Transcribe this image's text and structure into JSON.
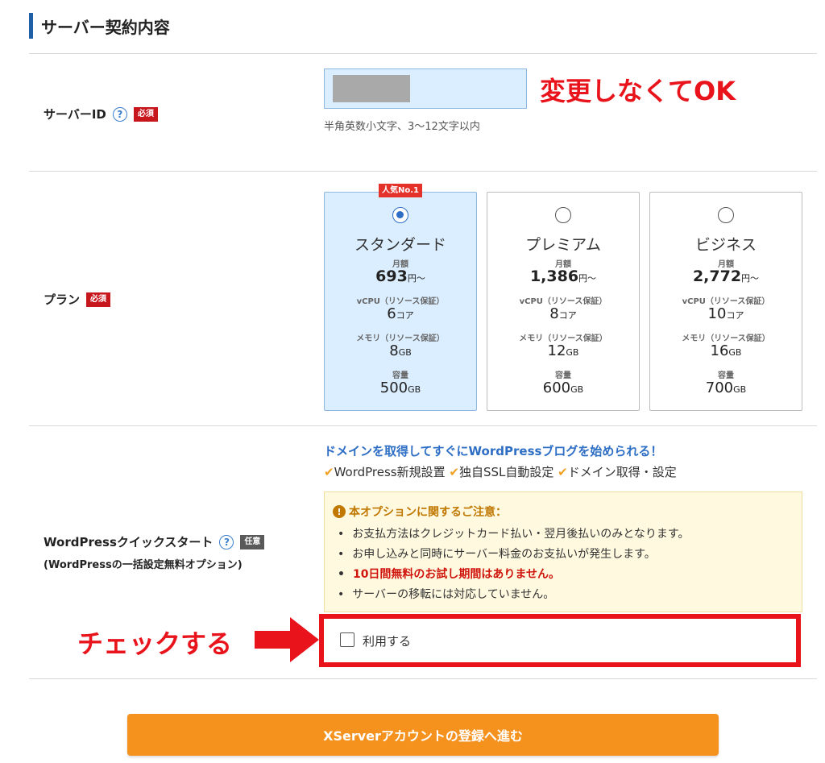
{
  "section": {
    "title": "サーバー契約内容"
  },
  "server_id": {
    "label": "サーバーID",
    "required_badge": "必須",
    "hint": "半角英数小文字、3～12文字以内",
    "annotation": "変更しなくてOK"
  },
  "plan": {
    "label": "プラン",
    "required_badge": "必須",
    "popular_badge": "人気No.1",
    "selected": "スタンダード",
    "items": [
      {
        "name": "スタンダード",
        "price_label": "月額",
        "price": "693",
        "price_unit": "円～",
        "cpu_label": "vCPU（リソース保証）",
        "cpu": "6",
        "cpu_unit": "コア",
        "mem_label": "メモリ（リソース保証）",
        "mem": "8",
        "mem_unit": "GB",
        "disk_label": "容量",
        "disk": "500",
        "disk_unit": "GB"
      },
      {
        "name": "プレミアム",
        "price_label": "月額",
        "price": "1,386",
        "price_unit": "円～",
        "cpu_label": "vCPU（リソース保証）",
        "cpu": "8",
        "cpu_unit": "コア",
        "mem_label": "メモリ（リソース保証）",
        "mem": "12",
        "mem_unit": "GB",
        "disk_label": "容量",
        "disk": "600",
        "disk_unit": "GB"
      },
      {
        "name": "ビジネス",
        "price_label": "月額",
        "price": "2,772",
        "price_unit": "円～",
        "cpu_label": "vCPU（リソース保証）",
        "cpu": "10",
        "cpu_unit": "コア",
        "mem_label": "メモリ（リソース保証）",
        "mem": "16",
        "mem_unit": "GB",
        "disk_label": "容量",
        "disk": "700",
        "disk_unit": "GB"
      }
    ]
  },
  "wordpress": {
    "label": "WordPressクイックスタート",
    "sublabel": "(WordPressの一括設定無料オプション)",
    "optional_badge": "任意",
    "headline": "ドメインを取得してすぐにWordPressブログを始められる！",
    "features": [
      "WordPress新規設置",
      "独自SSL自動設定",
      "ドメイン取得・設定"
    ],
    "notice_title": "本オプションに関するご注意：",
    "notice_items": [
      "お支払方法はクレジットカード払い・翌月後払いのみとなります。",
      "お申し込みと同時にサーバー料金のお支払いが発生します。",
      "10日間無料のお試し期間はありません。",
      "サーバーの移転には対応していません。"
    ],
    "checkbox_label": "利用する",
    "checked": false,
    "annotation": "チェックする"
  },
  "submit": {
    "label": "XServerアカウントの登録へ進む"
  },
  "colors": {
    "accent": "#2e6fc5",
    "annotation": "#e8131b",
    "button": "#f5921e",
    "required": "#c8161d"
  }
}
